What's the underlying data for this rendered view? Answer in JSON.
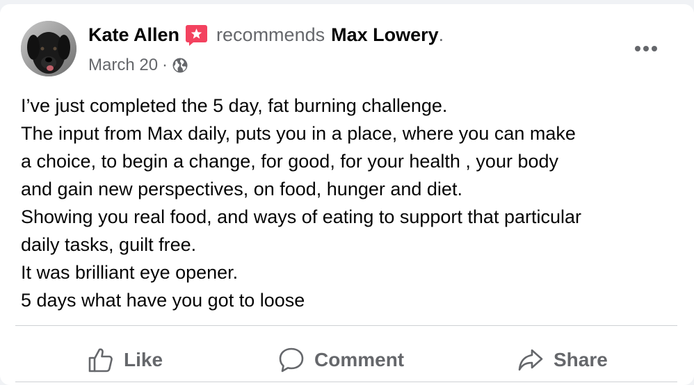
{
  "post": {
    "author": "Kate Allen",
    "verb": "recommends",
    "page": "Max Lowery",
    "end_punct": ".",
    "date": "March 20",
    "separator": "·",
    "privacy_icon": "globe-icon",
    "body_lines": [
      "I’ve just completed the 5 day, fat burning challenge.",
      "The input from Max daily, puts you in a place, where you can make",
      "a choice, to begin a change, for good, for your health , your body",
      "and gain new perspectives, on food, hunger and diet.",
      "Showing you real food, and ways of eating to support that particular",
      "daily tasks, guilt free.",
      "It was brilliant eye opener.",
      "5 days what have you got to loose"
    ]
  },
  "actions": {
    "like": "Like",
    "comment": "Comment",
    "share": "Share"
  },
  "colors": {
    "recommend_badge": "#f3425f",
    "secondary_text": "#65676b",
    "primary_text": "#050505"
  }
}
